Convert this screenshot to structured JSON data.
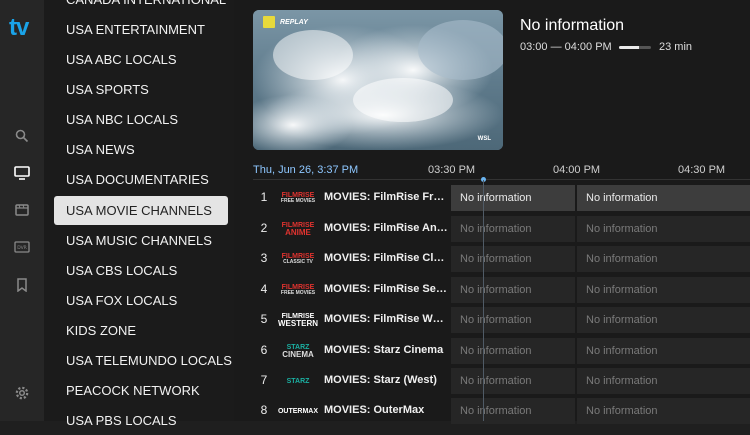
{
  "app_logo": "tv",
  "rail": {
    "icons": [
      "search-icon",
      "tv-icon",
      "film-icon",
      "dvr-icon",
      "bookmark-icon",
      "settings-icon"
    ],
    "active_icon": "tv-icon"
  },
  "categories": [
    "CANADA INTERNATIONAL",
    "USA ENTERTAINMENT",
    "USA ABC LOCALS",
    "USA SPORTS",
    "USA NBC LOCALS",
    "USA NEWS",
    "USA DOCUMENTARIES",
    "USA MOVIE CHANNELS",
    "USA MUSIC CHANNELS",
    "USA CBS LOCALS",
    "USA FOX LOCALS",
    "KIDS ZONE",
    "USA TELEMUNDO LOCALS",
    "PEACOCK NETWORK",
    "USA PBS LOCALS"
  ],
  "selected_category": "USA MOVIE CHANNELS",
  "preview": {
    "badge": "REPLAY",
    "watermark": "WSL"
  },
  "now_playing": {
    "title": "No information",
    "time_range": "03:00 — 04:00 PM",
    "progress": 0.62,
    "remaining": "23 min"
  },
  "guide": {
    "date_label": "Thu, Jun 26, 3:37 PM",
    "times": [
      "03:30 PM",
      "04:00 PM",
      "04:30 PM"
    ]
  },
  "channels": [
    {
      "num": "1",
      "logo_top": "FILMRISE",
      "logo_bottom": "FREE MOVIES",
      "logo_color": "#e0332f",
      "name": "MOVIES: FilmRise Free Movies",
      "programs": [
        "No information",
        "No information"
      ]
    },
    {
      "num": "2",
      "logo_top": "FILMRISE",
      "logo_bottom": "ANIME",
      "logo_color": "#e0332f",
      "name": "MOVIES: FilmRise Anime",
      "programs": [
        "No information",
        "No information"
      ]
    },
    {
      "num": "3",
      "logo_top": "FILMRISE",
      "logo_bottom": "CLASSIC TV",
      "logo_color": "#e0332f",
      "name": "MOVIES: FilmRise Classic TV",
      "programs": [
        "No information",
        "No information"
      ]
    },
    {
      "num": "4",
      "logo_top": "FILMRISE",
      "logo_bottom": "FREE MOVIES",
      "logo_color": "#e0332f",
      "name": "MOVIES: FilmRise Series",
      "programs": [
        "No information",
        "No information"
      ]
    },
    {
      "num": "5",
      "logo_top": "FILMRISE",
      "logo_bottom": "WESTERN",
      "logo_color": "#ffffff",
      "name": "MOVIES: FilmRise Western",
      "programs": [
        "No information",
        "No information"
      ]
    },
    {
      "num": "6",
      "logo_top": "STARZ",
      "logo_bottom": "CINEMA",
      "logo_color": "#1bb0a2",
      "name": "MOVIES: Starz Cinema",
      "programs": [
        "No information",
        "No information"
      ]
    },
    {
      "num": "7",
      "logo_top": "STARZ",
      "logo_bottom": "",
      "logo_color": "#1bb0a2",
      "name": "MOVIES: Starz (West)",
      "programs": [
        "No information",
        "No information"
      ]
    },
    {
      "num": "8",
      "logo_top": "OUTERMAX",
      "logo_bottom": "",
      "logo_color": "#ffffff",
      "name": "MOVIES: OuterMax",
      "programs": [
        "No information",
        "No information"
      ]
    }
  ],
  "focused_row": 0,
  "colors": {
    "accent": "#1aa3e8",
    "date_label": "#8ec7ff",
    "filmrise": "#e0332f",
    "starz": "#1bb0a2"
  }
}
